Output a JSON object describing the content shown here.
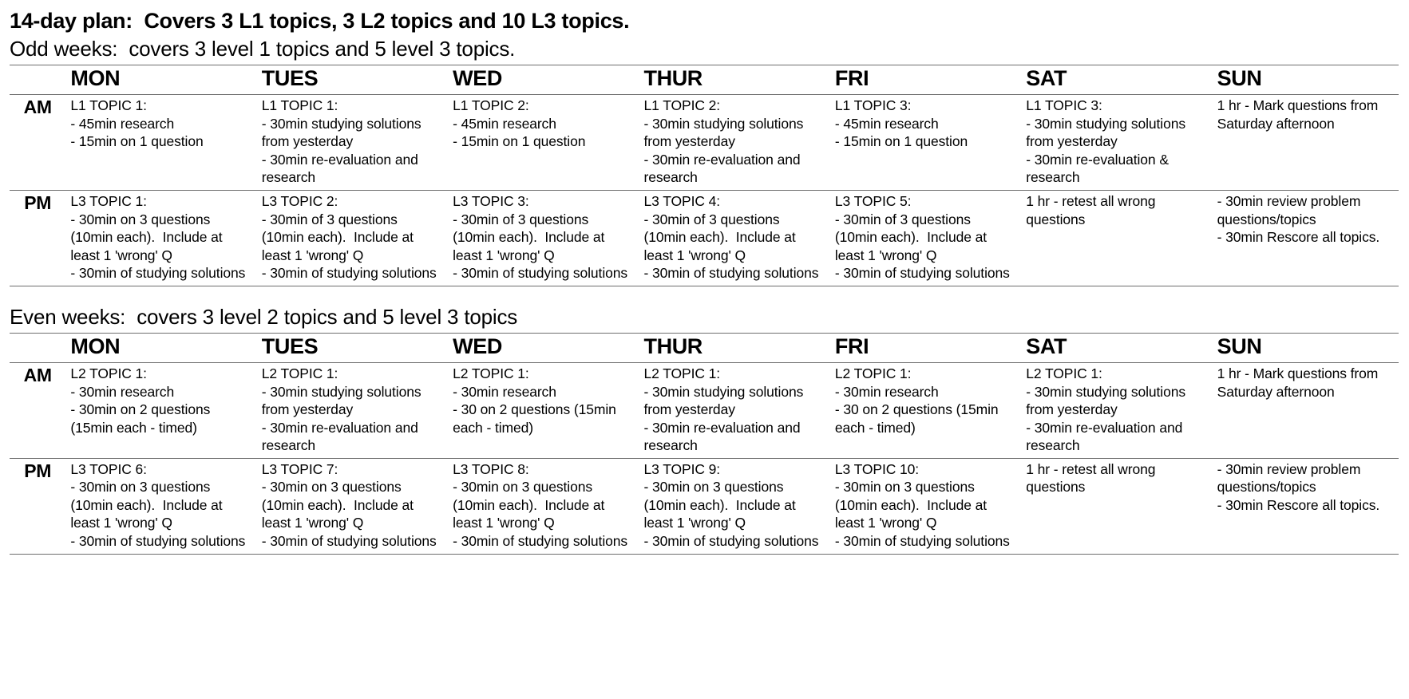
{
  "document": {
    "title": "14-day plan:  Covers 3 L1 topics, 3 L2 topics and 10 L3 topics.",
    "odd_heading": "Odd weeks:  covers 3 level 1 topics and 5 level 3 topics.",
    "even_heading": "Even weeks:  covers 3 level 2 topics and 5 level 3 topics"
  },
  "days": [
    "MON",
    "TUES",
    "WED",
    "THUR",
    "FRI",
    "SAT",
    "SUN"
  ],
  "periods": {
    "am": "AM",
    "pm": "PM"
  },
  "odd_week": {
    "am": [
      "L1 TOPIC 1:\n- 45min research\n- 15min on 1 question",
      "L1 TOPIC 1:\n- 30min studying solutions from yesterday\n- 30min re-evaluation and research",
      "L1 TOPIC 2:\n- 45min research\n- 15min on 1 question",
      "L1 TOPIC 2:\n- 30min studying solutions from yesterday\n- 30min re-evaluation and research",
      "L1 TOPIC 3:\n- 45min research\n- 15min on 1 question",
      "L1 TOPIC 3:\n- 30min studying solutions from yesterday\n- 30min re-evaluation & research",
      "1 hr - Mark questions from Saturday afternoon"
    ],
    "pm": [
      "L3 TOPIC 1:\n- 30min on 3 questions (10min each).  Include at least 1 'wrong' Q\n- 30min of studying solutions",
      "L3 TOPIC 2:\n- 30min of 3 questions (10min each).  Include at least 1 'wrong' Q\n- 30min of studying solutions",
      "L3 TOPIC 3:\n- 30min of 3 questions (10min each).  Include at least 1 'wrong' Q\n- 30min of studying solutions",
      "L3 TOPIC 4:\n- 30min of 3 questions (10min each).  Include at least 1 'wrong' Q\n- 30min of studying solutions",
      "L3 TOPIC 5:\n- 30min of 3 questions (10min each).  Include at least 1 'wrong' Q\n- 30min of studying solutions",
      "1 hr - retest all wrong questions",
      "- 30min review problem questions/topics\n- 30min Rescore all topics."
    ]
  },
  "even_week": {
    "am": [
      "L2 TOPIC 1:\n- 30min research\n- 30min on 2 questions (15min each - timed)",
      "L2 TOPIC 1:\n- 30min studying solutions from yesterday\n- 30min re-evaluation and research",
      "L2 TOPIC 1:\n- 30min research\n- 30 on 2 questions (15min each - timed)",
      "L2 TOPIC 1:\n- 30min studying solutions from yesterday\n- 30min re-evaluation and research",
      "L2 TOPIC 1:\n- 30min research\n- 30 on 2 questions (15min each - timed)",
      "L2 TOPIC 1:\n- 30min studying solutions from yesterday\n- 30min re-evaluation and research",
      "1 hr - Mark questions from Saturday afternoon"
    ],
    "pm": [
      "L3 TOPIC 6:\n- 30min on 3 questions (10min each).  Include at least 1 'wrong' Q\n- 30min of studying solutions",
      "L3 TOPIC 7:\n- 30min on 3 questions (10min each).  Include at least 1 'wrong' Q\n- 30min of studying solutions",
      "L3 TOPIC 8:\n- 30min on 3 questions (10min each).  Include at least 1 'wrong' Q\n- 30min of studying solutions",
      "L3 TOPIC 9:\n- 30min on 3 questions (10min each).  Include at least 1 'wrong' Q\n- 30min of studying solutions",
      "L3 TOPIC 10:\n- 30min on 3 questions (10min each).  Include at least 1 'wrong' Q\n- 30min of studying solutions",
      "1 hr - retest all wrong questions",
      "- 30min review problem questions/topics\n- 30min Rescore all topics."
    ]
  }
}
